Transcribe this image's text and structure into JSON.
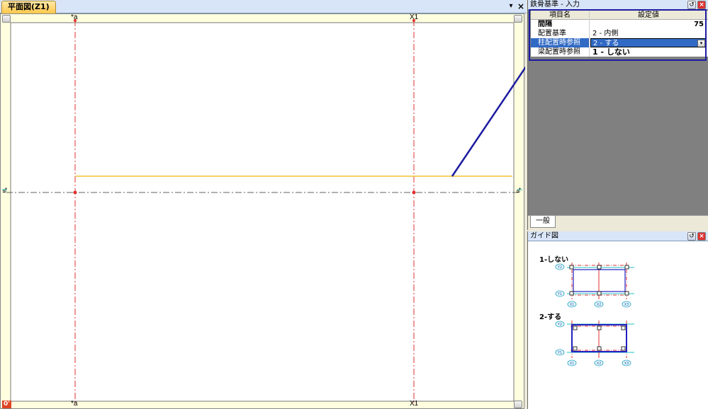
{
  "plan_window": {
    "tab_title": "平面図(Z1)",
    "pin_glyph": "▾",
    "close_glyph": "×",
    "grid_labels": {
      "col_a_top": "*a",
      "col_x1_top": "X1",
      "col_a_bottom": "*a",
      "col_x1_bottom": "X1",
      "row_left": "*a",
      "row_right": "*a"
    },
    "origin_badge": "0'"
  },
  "kijun_panel": {
    "title": "鉄骨基準 - 入力",
    "undock_glyph": "↺",
    "close_glyph": "×",
    "header": {
      "name": "項目名",
      "value": "設定値"
    },
    "rows": [
      {
        "name": "間隔",
        "value": "75"
      },
      {
        "name": "配置基準",
        "value": "2 - 内側"
      },
      {
        "name": "柱配置時参照",
        "value": "2 - する",
        "dropdown": "▾"
      },
      {
        "name": "梁配置時参照",
        "value": "1 - しない"
      }
    ],
    "tab_general": "一般"
  },
  "guide_panel": {
    "title": "ガイド図",
    "undock_glyph": "↺",
    "close_glyph": "×",
    "option1_label": "1-しない",
    "option2_label": "2-する",
    "axis_labels": {
      "y2": "Y2",
      "y1": "Y1",
      "x1": "X1",
      "x2": "X2",
      "x3": "X3"
    }
  },
  "colors": {
    "grid_line": "#e03030",
    "beam_line": "#f0c030",
    "callout": "#1c1ca0",
    "guide_frame": "#2020c0"
  }
}
